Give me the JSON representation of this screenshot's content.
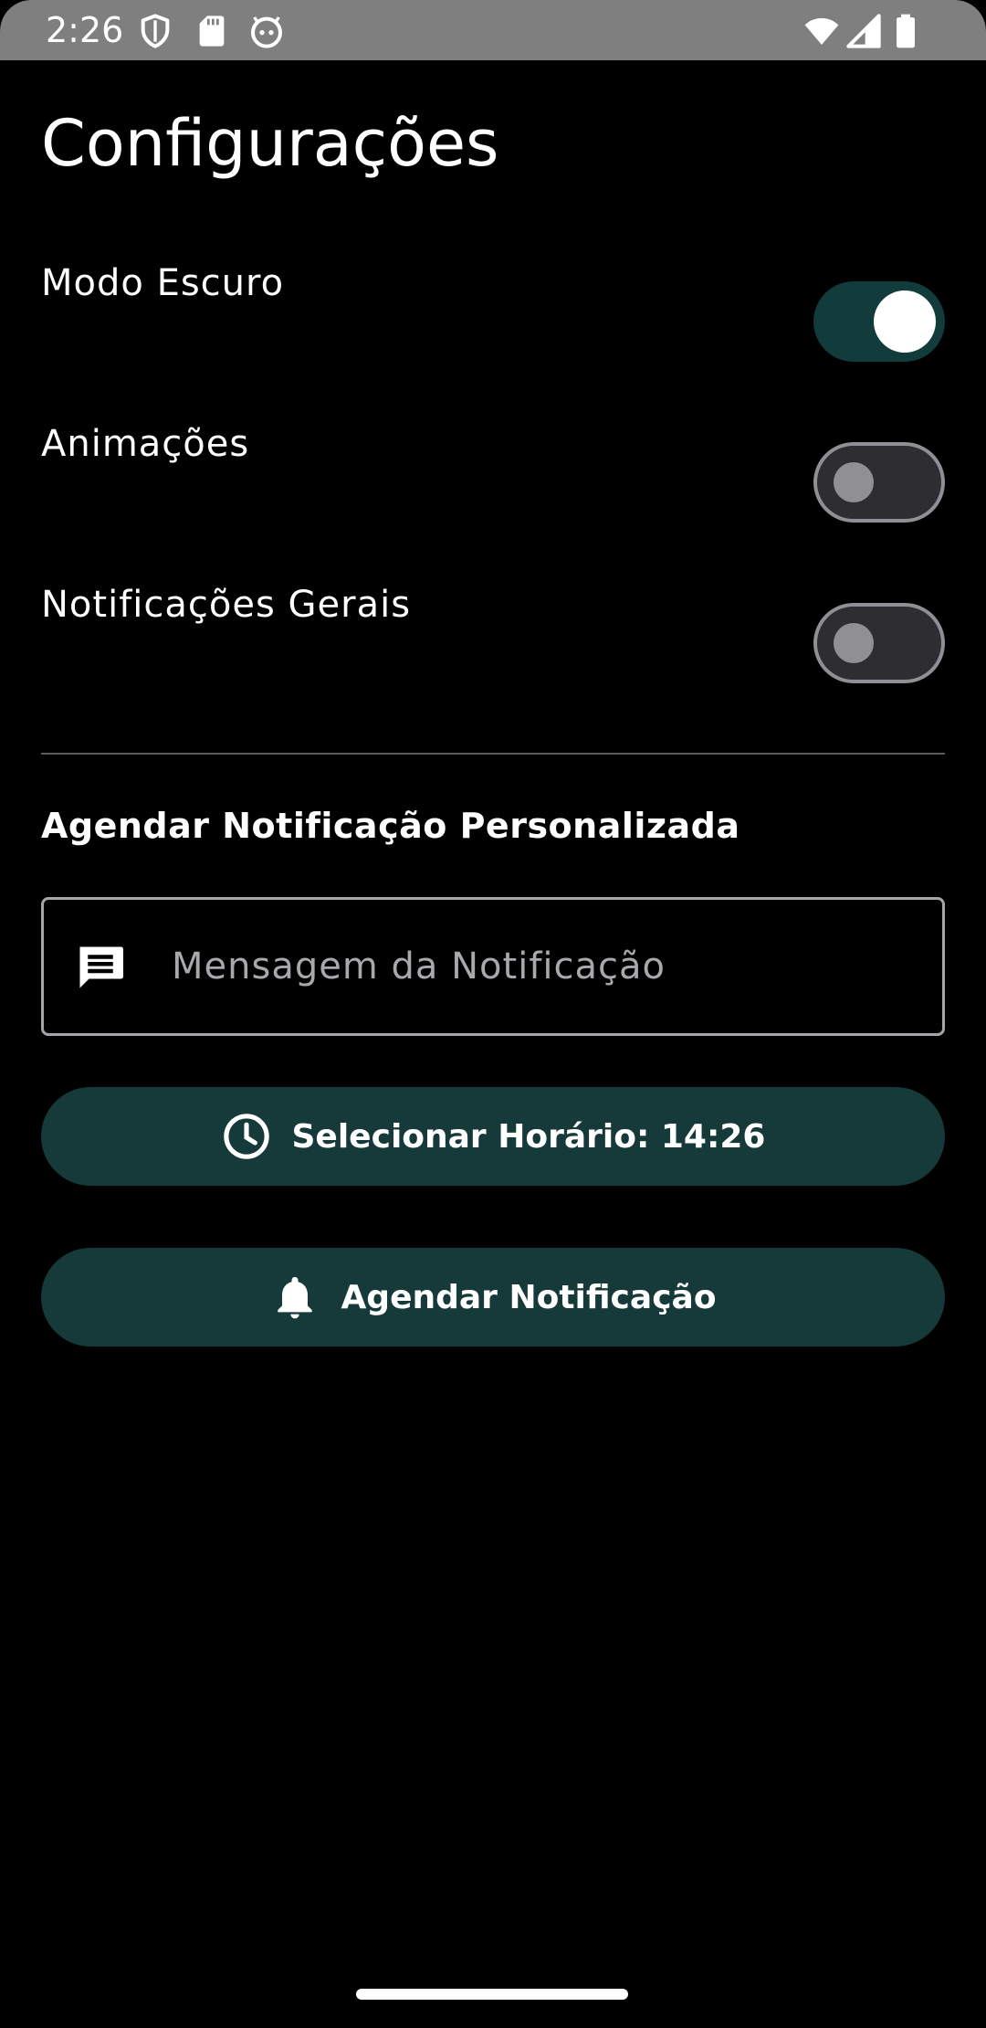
{
  "status_bar": {
    "time": "2:26",
    "left_icons": [
      "shield-icon",
      "sd-card-icon",
      "android-face-icon"
    ],
    "right_icons": [
      "wifi-icon",
      "cellular-signal-icon",
      "battery-icon"
    ],
    "background": "#7f7f7f"
  },
  "page": {
    "title": "Configurações"
  },
  "settings": [
    {
      "label": "Modo Escuro",
      "enabled": true
    },
    {
      "label": "Animações",
      "enabled": false
    },
    {
      "label": "Notificações Gerais",
      "enabled": false
    }
  ],
  "schedule_section": {
    "title": "Agendar Notificação Personalizada",
    "message_input": {
      "placeholder": "Mensagem da Notificação",
      "value": "",
      "icon": "message-icon"
    },
    "time_button": {
      "label": "Selecionar Horário: 14:26",
      "icon": "clock-icon"
    },
    "schedule_button": {
      "label": "Agendar Notificação",
      "icon": "bell-icon"
    }
  },
  "colors": {
    "background": "#000000",
    "accent": "#163a3a",
    "switch_on_track": "#123c3c",
    "switch_off_track": "#2e2e32",
    "switch_off_outline": "#8f8f94",
    "text": "#ffffff"
  }
}
